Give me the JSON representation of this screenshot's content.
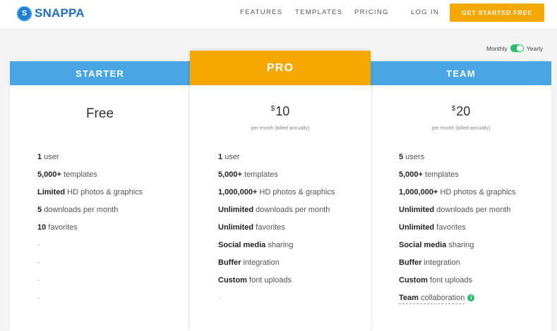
{
  "header": {
    "logo_letter": "S",
    "logo_text": "SNAPPA",
    "nav": [
      "FEATURES",
      "TEMPLATES",
      "PRICING",
      "LOG IN"
    ],
    "cta_label": "GET STARTED FREE"
  },
  "billing_toggle": {
    "left_label": "Monthly",
    "right_label": "Yearly",
    "selected": "Yearly"
  },
  "colors": {
    "brand_blue": "#4aa6e2",
    "accent_orange": "#f5a800",
    "toggle_green": "#2dbd6e"
  },
  "plans": {
    "starter": {
      "name": "STARTER",
      "price": "Free",
      "features": [
        {
          "bold": "1",
          "rest": " user"
        },
        {
          "bold": "5,000+",
          "rest": " templates"
        },
        {
          "bold": "Limited",
          "rest": " HD photos & graphics"
        },
        {
          "bold": "5",
          "rest": " downloads per month"
        },
        {
          "bold": "10",
          "rest": " favorites"
        },
        {
          "bold": "",
          "rest": "-"
        },
        {
          "bold": "",
          "rest": "-"
        },
        {
          "bold": "",
          "rest": "-"
        },
        {
          "bold": "",
          "rest": "-"
        }
      ]
    },
    "pro": {
      "name": "PRO",
      "currency": "$",
      "amount": "10",
      "price_note": "per month (billed annually)",
      "features": [
        {
          "bold": "1",
          "rest": " user"
        },
        {
          "bold": "5,000+",
          "rest": " templates"
        },
        {
          "bold": "1,000,000+",
          "rest": " HD photos & graphics"
        },
        {
          "bold": "Unlimited",
          "rest": " downloads per month"
        },
        {
          "bold": "Unlimited",
          "rest": " favorites"
        },
        {
          "bold": "Social media",
          "rest": " sharing"
        },
        {
          "bold": "Buffer",
          "rest": " integration"
        },
        {
          "bold": "Custom",
          "rest": " font uploads"
        },
        {
          "bold": "",
          "rest": "-"
        }
      ]
    },
    "team": {
      "name": "TEAM",
      "currency": "$",
      "amount": "20",
      "price_note": "per month (billed annually)",
      "features": [
        {
          "bold": "5",
          "rest": " users"
        },
        {
          "bold": "5,000+",
          "rest": " templates"
        },
        {
          "bold": "1,000,000+",
          "rest": " HD photos & graphics"
        },
        {
          "bold": "Unlimited",
          "rest": " downloads per month"
        },
        {
          "bold": "Unlimited",
          "rest": " favorites"
        },
        {
          "bold": "Social media",
          "rest": " sharing"
        },
        {
          "bold": "Buffer",
          "rest": " integration"
        },
        {
          "bold": "Custom",
          "rest": " font uploads"
        },
        {
          "bold": "Team",
          "rest": " collaboration",
          "info_icon": "info-icon"
        }
      ]
    }
  }
}
